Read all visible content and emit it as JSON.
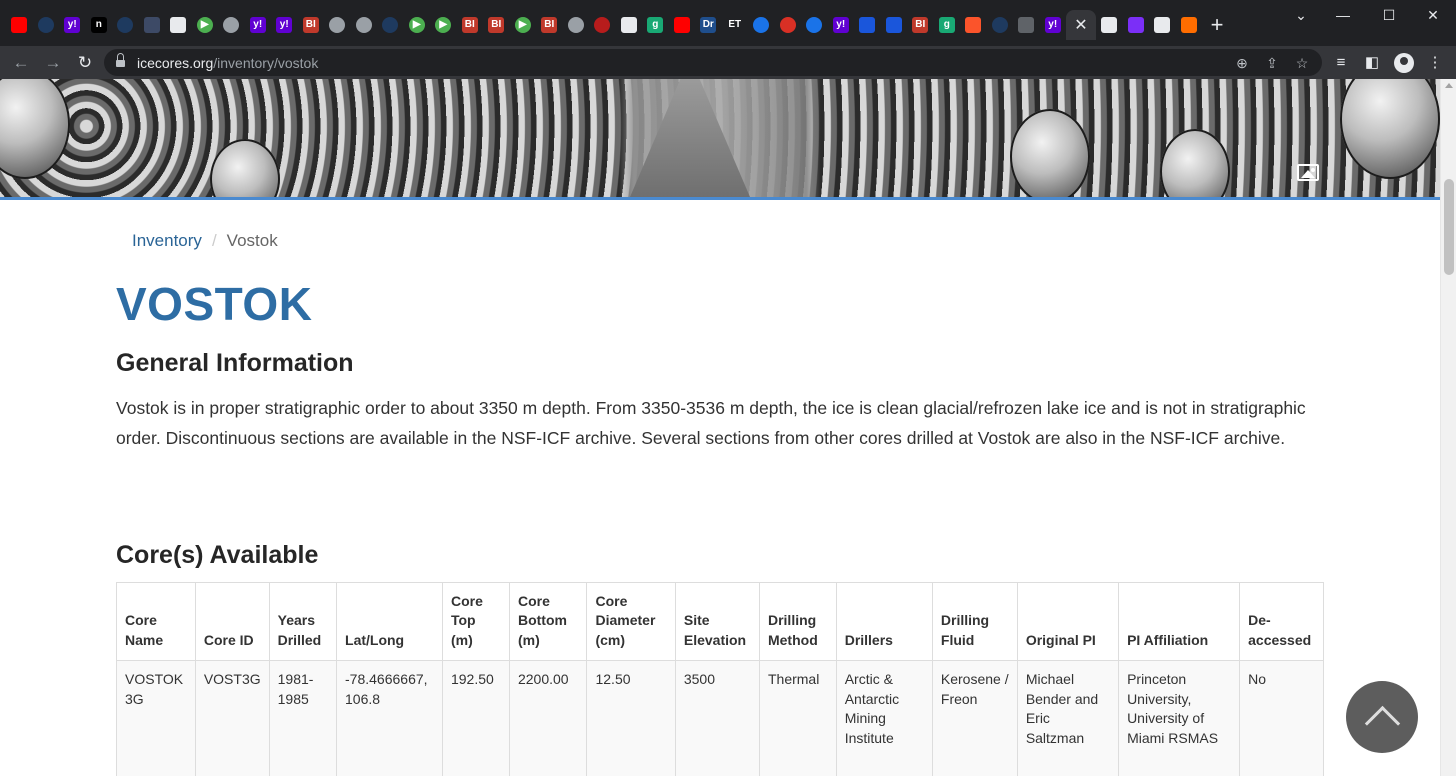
{
  "browser": {
    "tab_favicons": [
      {
        "icon": "youtube-icon",
        "color": "#ff0000",
        "text": "",
        "round": false
      },
      {
        "icon": "shield-icon",
        "color": "#1e3a5f",
        "text": "",
        "round": true
      },
      {
        "icon": "yahoo-icon",
        "color": "#6001d2",
        "text": "y!",
        "round": false
      },
      {
        "icon": "n-icon",
        "color": "#000000",
        "text": "n",
        "round": false
      },
      {
        "icon": "shield-icon",
        "color": "#1e3a5f",
        "text": "",
        "round": true
      },
      {
        "icon": "bookmark-icon",
        "color": "#3d4a66",
        "text": "",
        "round": false
      },
      {
        "icon": "image-icon",
        "color": "#e8eaed",
        "text": "",
        "round": false
      },
      {
        "icon": "play-icon",
        "color": "#4caf50",
        "text": "▶",
        "round": true
      },
      {
        "icon": "globe-icon",
        "color": "#9aa0a6",
        "text": "",
        "round": true
      },
      {
        "icon": "yahoo-icon",
        "color": "#6001d2",
        "text": "y!",
        "round": false
      },
      {
        "icon": "yahoo-icon",
        "color": "#6001d2",
        "text": "y!",
        "round": false
      },
      {
        "icon": "bi-icon",
        "color": "#c0392b",
        "text": "BI",
        "round": false
      },
      {
        "icon": "globe-icon",
        "color": "#9aa0a6",
        "text": "",
        "round": true
      },
      {
        "icon": "globe-icon",
        "color": "#9aa0a6",
        "text": "",
        "round": true
      },
      {
        "icon": "shield-icon",
        "color": "#1e3a5f",
        "text": "",
        "round": true
      },
      {
        "icon": "play-icon",
        "color": "#4caf50",
        "text": "▶",
        "round": true
      },
      {
        "icon": "play-icon",
        "color": "#4caf50",
        "text": "▶",
        "round": true
      },
      {
        "icon": "bi-icon",
        "color": "#c0392b",
        "text": "BI",
        "round": false
      },
      {
        "icon": "bi-icon",
        "color": "#c0392b",
        "text": "BI",
        "round": false
      },
      {
        "icon": "play-icon",
        "color": "#4caf50",
        "text": "▶",
        "round": true
      },
      {
        "icon": "bi-icon",
        "color": "#c0392b",
        "text": "BI",
        "round": false
      },
      {
        "icon": "globe-icon",
        "color": "#9aa0a6",
        "text": "",
        "round": true
      },
      {
        "icon": "burst-icon",
        "color": "#b71c1c",
        "text": "",
        "round": true
      },
      {
        "icon": "news-icon",
        "color": "#e8eaed",
        "text": "",
        "round": false
      },
      {
        "icon": "g-icon",
        "color": "#19a974",
        "text": "g",
        "round": false
      },
      {
        "icon": "youtube-icon",
        "color": "#ff0000",
        "text": "",
        "round": false
      },
      {
        "icon": "dr-icon",
        "color": "#1f4e8c",
        "text": "Dr",
        "round": false
      },
      {
        "icon": "et-icon",
        "color": "#202124",
        "text": "ET",
        "round": false
      },
      {
        "icon": "circle-icon",
        "color": "#1a73e8",
        "text": "",
        "round": true
      },
      {
        "icon": "mic-icon",
        "color": "#d93025",
        "text": "",
        "round": true
      },
      {
        "icon": "search-icon",
        "color": "#1a73e8",
        "text": "",
        "round": true
      },
      {
        "icon": "yahoo-icon",
        "color": "#6001d2",
        "text": "y!",
        "round": false
      },
      {
        "icon": "hex-icon",
        "color": "#1a56db",
        "text": "",
        "round": false
      },
      {
        "icon": "hex-icon",
        "color": "#1a56db",
        "text": "",
        "round": false
      },
      {
        "icon": "bi-icon",
        "color": "#c0392b",
        "text": "BI",
        "round": false
      },
      {
        "icon": "g-icon",
        "color": "#19a974",
        "text": "g",
        "round": false
      },
      {
        "icon": "brave-icon",
        "color": "#fb542b",
        "text": "",
        "round": false
      },
      {
        "icon": "shield-icon",
        "color": "#1e3a5f",
        "text": "",
        "round": true
      },
      {
        "icon": "crest-icon",
        "color": "#5f6368",
        "text": "",
        "round": false
      },
      {
        "icon": "yahoo-icon",
        "color": "#6001d2",
        "text": "y!",
        "round": false
      }
    ],
    "trailing_favicons": [
      {
        "icon": "speaker-icon",
        "color": "#e8eaed",
        "text": "",
        "round": false
      },
      {
        "icon": "purple-bar-icon",
        "color": "#7b2ff7",
        "text": "",
        "round": false
      },
      {
        "icon": "scale-icon",
        "color": "#e8eaed",
        "text": "",
        "round": false
      },
      {
        "icon": "stack-icon",
        "color": "#ff6d00",
        "text": "",
        "round": false
      }
    ],
    "url_host": "icecores.org",
    "url_path": "/inventory/vostok"
  },
  "breadcrumb": {
    "parent": "Inventory",
    "current": "Vostok"
  },
  "page": {
    "title": "VOSTOK",
    "general_heading": "General Information",
    "general_text": "Vostok is in proper stratigraphic order to about 3350 m depth. From 3350-3536 m depth, the ice is clean glacial/refrozen lake ice and is not in stratigraphic order. Discontinuous sections are available in the NSF-ICF archive. Several sections from other cores drilled at Vostok are also in the NSF-ICF archive.",
    "cores_heading": "Core(s) Available"
  },
  "table": {
    "headers": [
      "Core Name",
      "Core ID",
      "Years Drilled",
      "Lat/Long",
      "Core Top (m)",
      "Core Bottom (m)",
      "Core Diameter (cm)",
      "Site Elevation",
      "Drilling Method",
      "Drillers",
      "Drilling Fluid",
      "Original PI",
      "PI Affiliation",
      "De-accessed"
    ],
    "rows": [
      [
        "VOSTOK 3G",
        "VOST3G",
        "1981-1985",
        "-78.4666667, 106.8",
        "192.50",
        "2200.00",
        "12.50",
        "3500",
        "Thermal",
        "Arctic & Antarctic Mining Institute",
        "Kerosene / Freon",
        "Michael Bender and Eric Saltzman",
        "Princeton University, University of Miami RSMAS",
        "No"
      ]
    ]
  }
}
